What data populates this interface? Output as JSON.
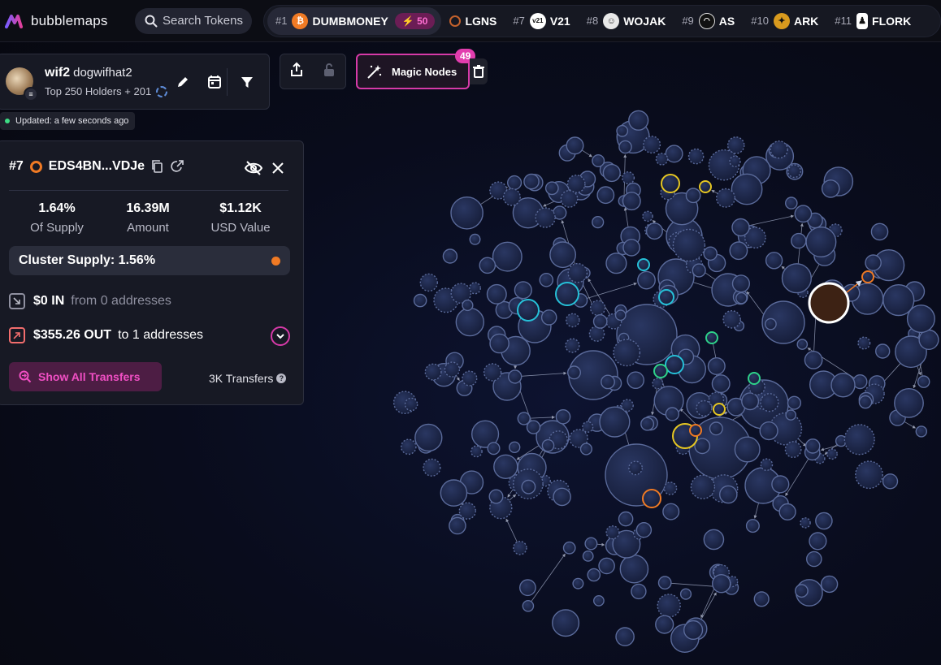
{
  "app": {
    "name": "bubblemaps"
  },
  "search": {
    "placeholder": "Search Tokens"
  },
  "trending": [
    {
      "rank": "#1",
      "symbol": "DUMBMONEY",
      "boost": "50",
      "icon": "dumbmoney-coin-icon",
      "color": "#f07a24",
      "active": true
    },
    {
      "rank": "",
      "symbol": "LGNS",
      "icon": "lgns-icon",
      "color": "#c2612c"
    },
    {
      "rank": "#7",
      "symbol": "V21",
      "icon": "v21-icon",
      "color": "#ffffff"
    },
    {
      "rank": "#8",
      "symbol": "WOJAK",
      "icon": "wojak-icon",
      "color": "#e8e8e8"
    },
    {
      "rank": "#9",
      "symbol": "AS",
      "icon": "as-icon",
      "color": "#1a1a1a"
    },
    {
      "rank": "#10",
      "symbol": "ARK",
      "icon": "ark-icon",
      "color": "#d89a1e"
    },
    {
      "rank": "#11",
      "symbol": "FLORK",
      "icon": "flork-icon",
      "color": "#ffffff"
    }
  ],
  "token": {
    "symbol": "wif2",
    "name": "dogwifhat2",
    "subtitle": "Top 250 Holders + 201",
    "chain_icon": "solana-icon",
    "updated": "Updated: a few seconds ago"
  },
  "magic_nodes": {
    "label": "Magic Nodes",
    "count": "49"
  },
  "holder": {
    "rank": "#7",
    "address": "EDS4BN...VDJe",
    "stats": [
      {
        "value": "1.64%",
        "label": "Of Supply"
      },
      {
        "value": "16.39M",
        "label": "Amount"
      },
      {
        "value": "$1.12K",
        "label": "USD Value"
      }
    ],
    "cluster_supply": "Cluster Supply: 1.56%",
    "in_amount": "$0 IN",
    "in_detail": "from 0 addresses",
    "out_amount": "$355.26 OUT",
    "out_detail": "to 1 addresses",
    "show_transfers": "Show All Transfers",
    "transfer_count": "3K Transfers"
  },
  "colors": {
    "accent": "#d63aa8",
    "highlight_orange": "#f07a24",
    "bubble_fill": "#1c2444",
    "bubble_stroke": "#5a6a9a",
    "cyan": "#26c0d8",
    "green": "#2ed18a",
    "yellow": "#e5c622"
  }
}
